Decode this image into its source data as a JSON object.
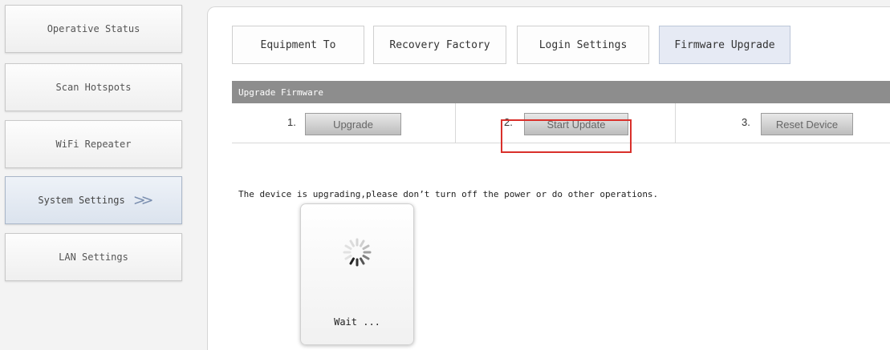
{
  "sidebar": {
    "items": [
      {
        "label": "Operative Status"
      },
      {
        "label": "Scan Hotspots"
      },
      {
        "label": "WiFi Repeater"
      },
      {
        "label": "System Settings",
        "active": true
      },
      {
        "label": "LAN Settings"
      }
    ],
    "active_indicator": "double-chevron-right-icon"
  },
  "tabs": [
    {
      "label": "Equipment To"
    },
    {
      "label": "Recovery Factory"
    },
    {
      "label": "Login Settings"
    },
    {
      "label": "Firmware Upgrade",
      "active": true
    }
  ],
  "section": {
    "title": "Upgrade Firmware"
  },
  "steps": [
    {
      "number": "1.",
      "button": "Upgrade"
    },
    {
      "number": "2.",
      "button": "Start Update"
    },
    {
      "number": "3.",
      "button": "Reset Device"
    }
  ],
  "message": "The device is upgrading,please don’t turn off the power or do other operations.",
  "modal": {
    "text": "Wait ...",
    "icon": "loading-spinner-icon"
  },
  "colors": {
    "section_bar": "#8d8d8d",
    "highlight": "#d9302b",
    "active_tab": "#e6eaf4"
  }
}
